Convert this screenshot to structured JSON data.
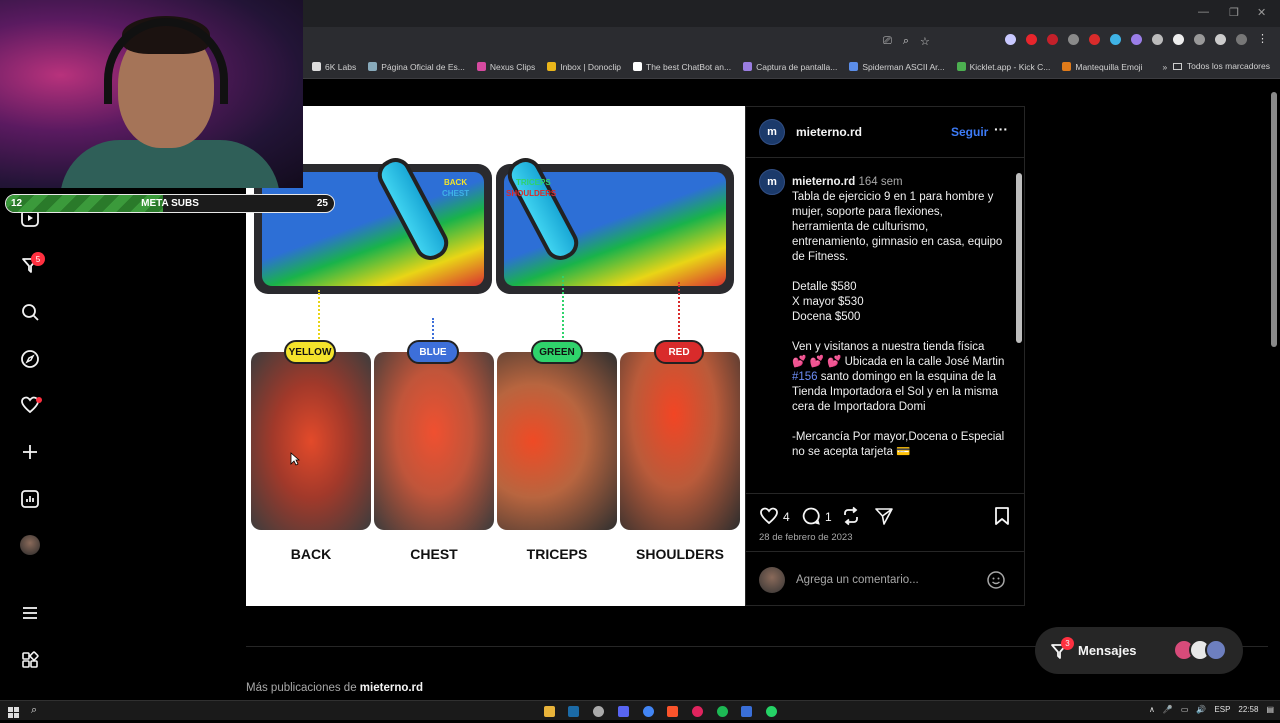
{
  "browser": {
    "bookmarks": [
      "6K Labs",
      "Página Oficial de Es...",
      "Nexus Clips",
      "Inbox | Donoclip",
      "The best ChatBot an...",
      "Captura de pantalla...",
      "Spiderman ASCII Ar...",
      "Kicklet.app - Kick C...",
      "Mantequilla Emoji"
    ],
    "bookmarks_overflow": "»",
    "all_bookmarks": "Todos los marcadores"
  },
  "overlay": {
    "meta_current": "12",
    "meta_label": "META SUBS",
    "meta_goal": "25",
    "progress_fraction": 0.48
  },
  "sidebar": {
    "notifications_badge": "5",
    "items": [
      "reels-icon",
      "messages-filter-icon",
      "search-icon",
      "explore-icon",
      "activity-icon",
      "create-icon",
      "dashboard-icon",
      "profile-avatar",
      "menu-icon",
      "more-apps-icon"
    ]
  },
  "post_image": {
    "board_left_labels": [
      "BACK",
      "CHEST"
    ],
    "board_right_labels": [
      "TRICEPS",
      "SHOULDERS"
    ],
    "muscles": [
      {
        "pill": "YELLOW",
        "label": "BACK",
        "color": "#f4e32b"
      },
      {
        "pill": "BLUE",
        "label": "CHEST",
        "color": "#3d6fd9"
      },
      {
        "pill": "GREEN",
        "label": "TRICEPS",
        "color": "#2fd36b"
      },
      {
        "pill": "RED",
        "label": "SHOULDERS",
        "color": "#d92b2b"
      }
    ]
  },
  "post": {
    "username": "mieterno.rd",
    "avatar_text": "m",
    "follow_label": "Seguir",
    "more_label": "···",
    "caption_user": "mieterno.rd",
    "caption_age": "164 sem",
    "caption": "Tabla de ejercicio 9 en 1 para hombre y mujer, soporte para flexiones, herramienta de culturismo, entrenamiento, gimnasio en casa, equipo de Fitness.\n\nDetalle $580\nX mayor $530\nDocena $500\n\nVen y visitanos a nuestra tienda física",
    "caption_hearts": "💕 💕 💕",
    "caption_location_1": "Ubicada en la calle José Martin",
    "caption_hashtag": "#156",
    "caption_location_2": "santo domingo en la esquina de la Tienda Importadora el Sol y en la misma cera de Importadora Domi",
    "caption_wholesale": "-Mercancía Por mayor,Docena o Especial no se acepta tarjeta",
    "caption_card_emoji": "💳",
    "likes": "4",
    "comments": "1",
    "date": "28 de febrero de 2023",
    "comment_placeholder": "Agrega un comentario..."
  },
  "more_posts": {
    "prefix": "Más publicaciones de",
    "user": "mieterno.rd"
  },
  "messages": {
    "label": "Mensajes",
    "badge": "3"
  },
  "taskbar": {
    "language": "ESP",
    "time": "22:58"
  }
}
